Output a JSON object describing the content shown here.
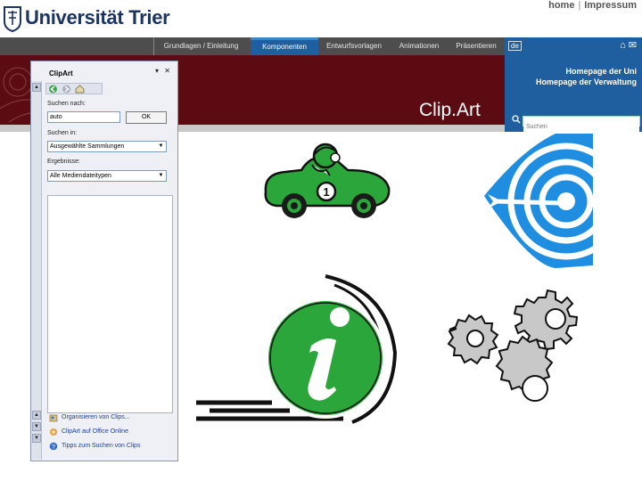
{
  "header": {
    "logo_text": "Universität Trier",
    "top_links": [
      "home",
      "Impressum"
    ]
  },
  "nav": {
    "tabs": [
      "Grundlagen / Einleitung",
      "Komponenten",
      "Entwurfsvorlagen",
      "Animationen",
      "Präsentieren"
    ],
    "active_index": 1
  },
  "banner": {
    "title": "Clip.Art"
  },
  "rightbox": {
    "lang": "de",
    "links": [
      "Homepage der Uni",
      "Homepage der Verwaltung"
    ],
    "search_placeholder": "Suchen"
  },
  "clipart_pane": {
    "title": "ClipArt",
    "search_label": "Suchen nach:",
    "search_value": "auto",
    "ok_label": "OK",
    "search_in_label": "Suchen in:",
    "search_in_value": "Ausgewählte Sammlungen",
    "results_label": "Ergebnisse:",
    "results_value": "Alle Mediendateitypen",
    "links": [
      "Organisieren von Clips...",
      "ClipArt auf Office Online",
      "Tipps zum Suchen von Clips"
    ]
  },
  "colors": {
    "nav_bg": "#4d4d4d",
    "nav_active": "#1f5fa0",
    "banner": "#5c0b12",
    "rightbox": "#1f5fa0",
    "clip_green": "#2aa63a",
    "clip_blue": "#1f8ee0"
  },
  "icons": [
    "university-seal-icon",
    "home-icon",
    "mail-icon",
    "search-icon",
    "race-car-clipart",
    "target-clipart",
    "info-clipart",
    "gears-clipart"
  ]
}
